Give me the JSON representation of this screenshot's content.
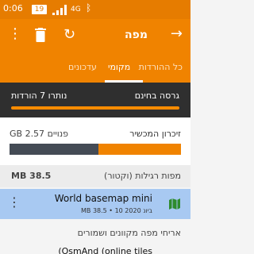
{
  "status_bar": {
    "time": "0:06",
    "battery": "19",
    "network": "4G",
    "bluetooth_icon": "bluetooth-icon"
  },
  "app_bar": {
    "title": "מפה",
    "icons": [
      "back-arrow-icon",
      "kebab-menu-icon",
      "trash-icon",
      "refresh-icon"
    ]
  },
  "tabs": [
    {
      "label": "כל ההורדות",
      "active": false
    },
    {
      "label": "מקומי",
      "active": true
    },
    {
      "label": "עדכונים",
      "active": false
    }
  ],
  "version": {
    "label": "גרסה בחינם",
    "remaining": "נותרו 7 הורדות"
  },
  "memory": {
    "label": "זיכרון המכשיר",
    "free": "GB 2.57 פנויים",
    "used_fraction": 0.52
  },
  "vector_section": {
    "label": "מפות רגילות (וקטור)",
    "size": "MB 38.5"
  },
  "map_item": {
    "name": "World basemap mini",
    "meta": "MB 38.5 • 10 ביונ 2020",
    "icon": "map-icon",
    "selected": true
  },
  "archive_section": {
    "label": "אריחי מפה מקוונים ושמורים",
    "sub_item": "(OsmAnd (online tiles"
  },
  "colors": {
    "status_bar": "#e67c00",
    "app_bar": "#f08300",
    "version_band": "#2f2f2f",
    "selected_row": "#a8c9f2",
    "memory_used": "#444b55"
  }
}
